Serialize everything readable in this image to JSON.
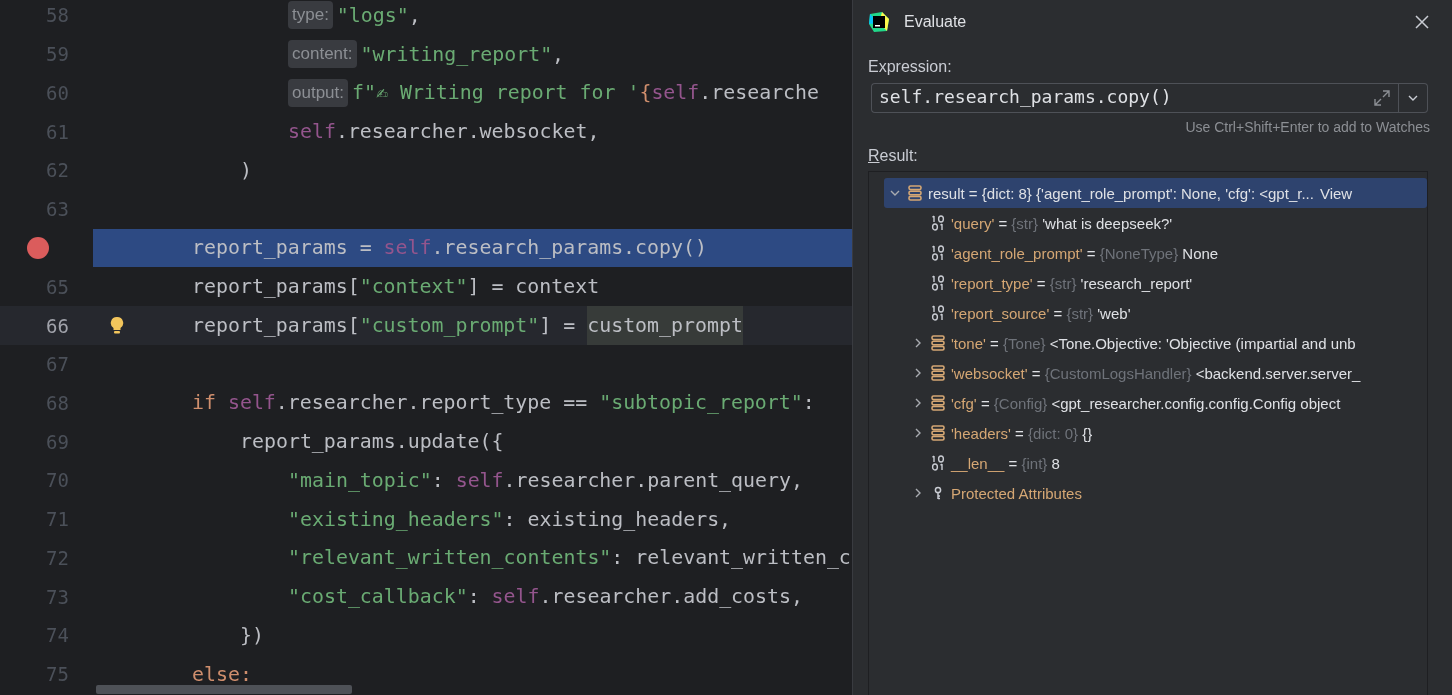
{
  "editor": {
    "lines": [
      {
        "children": [
          {
            "children": [
              {
                "number": "58",
                "tokens": [
                  {
                    "kind": "hint",
                    "text": "type:"
                  },
                  {
                    "kind": "str",
                    "text": "\"logs\""
                  },
                  {
                    "kind": "plain",
                    "text": ","
                  }
                ]
              },
              {
                "number": "59",
                "tokens": [
                  {
                    "kind": "hint",
                    "text": "content:"
                  },
                  {
                    "kind": "str",
                    "text": "\"writing_report\""
                  },
                  {
                    "kind": "plain",
                    "text": ","
                  }
                ]
              },
              {
                "number": "60",
                "tokens": [
                  {
                    "kind": "hint",
                    "text": "output:"
                  },
                  {
                    "kind": "str",
                    "text": "f\"✍ Writing report for '"
                  },
                  {
                    "kind": "kw",
                    "text": "{"
                  },
                  {
                    "kind": "self",
                    "text": "self"
                  },
                  {
                    "kind": "plain",
                    "text": ".researche"
                  }
                ]
              },
              {
                "number": "61",
                "tokens": [
                  {
                    "kind": "self",
                    "text": "self"
                  },
                  {
                    "kind": "plain",
                    "text": ".researcher.websocket,"
                  }
                ]
              }
            ]
          },
          {
            "number": "62",
            "tokens": [
              {
                "kind": "plain",
                "text": ")"
              }
            ]
          }
        ]
      },
      {
        "number": "63"
      },
      {
        "breakpoint": true,
        "execution": true,
        "tokens": [
          {
            "kind": "plain",
            "text": "report_params = "
          },
          {
            "kind": "self",
            "text": "self"
          },
          {
            "kind": "plain",
            "text": ".research_params.copy()"
          }
        ]
      },
      {
        "number": "65",
        "tokens": [
          {
            "kind": "plain",
            "text": "report_params["
          },
          {
            "kind": "str",
            "text": "\"context\""
          },
          {
            "kind": "plain",
            "text": "] = context"
          }
        ]
      },
      {
        "number": "66",
        "current": true,
        "bulb": true,
        "tokens": [
          {
            "kind": "plain",
            "text": "report_params["
          },
          {
            "kind": "str",
            "text": "\"custom_prompt\""
          },
          {
            "kind": "plain",
            "text": "] = "
          },
          {
            "kind": "usage",
            "text": "custom_prompt"
          }
        ]
      },
      {
        "number": "67"
      },
      {
        "number": "68",
        "tokens": [
          {
            "kind": "kw",
            "text": "if "
          },
          {
            "kind": "self",
            "text": "self"
          },
          {
            "kind": "plain",
            "text": ".researcher.report_type == "
          },
          {
            "kind": "str",
            "text": "\"subtopic_report\""
          },
          {
            "kind": "plain",
            "text": ":"
          }
        ],
        "children": [
          {
            "number": "69",
            "tokens": [
              {
                "kind": "plain",
                "text": "report_params.update({"
              }
            ],
            "children": [
              {
                "number": "70",
                "tokens": [
                  {
                    "kind": "str",
                    "text": "\"main_topic\""
                  },
                  {
                    "kind": "plain",
                    "text": ": "
                  },
                  {
                    "kind": "self",
                    "text": "self"
                  },
                  {
                    "kind": "plain",
                    "text": ".researcher.parent_query,"
                  }
                ]
              },
              {
                "number": "71",
                "tokens": [
                  {
                    "kind": "str",
                    "text": "\"existing_headers\""
                  },
                  {
                    "kind": "plain",
                    "text": ": existing_headers,"
                  }
                ]
              },
              {
                "number": "72",
                "tokens": [
                  {
                    "kind": "str",
                    "text": "\"relevant_written_contents\""
                  },
                  {
                    "kind": "plain",
                    "text": ": relevant_written_c"
                  }
                ]
              },
              {
                "number": "73",
                "tokens": [
                  {
                    "kind": "str",
                    "text": "\"cost_callback\""
                  },
                  {
                    "kind": "plain",
                    "text": ": "
                  },
                  {
                    "kind": "self",
                    "text": "self"
                  },
                  {
                    "kind": "plain",
                    "text": ".researcher.add_costs,"
                  }
                ]
              }
            ]
          },
          {
            "number": "74",
            "tokens": [
              {
                "kind": "plain",
                "text": "})"
              }
            ]
          }
        ]
      },
      {
        "number": "75",
        "tokens": [
          {
            "kind": "kw",
            "text": "else:"
          }
        ]
      }
    ]
  },
  "dialog": {
    "title": "Evaluate",
    "expression_label": "Expression:",
    "expression": "self.research_params.copy()",
    "hint": "Use Ctrl+Shift+Enter to add to Watches",
    "result_label": "Result:",
    "tree": [
      {
        "kind": "dict",
        "name": "result",
        "operator": "=",
        "type": "{dict: 8}",
        "value": "{'agent_role_prompt': None, 'cfg': <gpt_r...",
        "link": "View",
        "expanded": true,
        "selected": true,
        "children": [
          {
            "kind": "prim",
            "name": "'query'",
            "operator": "=",
            "type": "{str}",
            "value": "'what is deepseek?'",
            "selected": false
          },
          {
            "kind": "prim",
            "name": "'agent_role_prompt'",
            "operator": "=",
            "type": "{NoneType}",
            "value": "None",
            "selected": false
          },
          {
            "kind": "prim",
            "name": "'report_type'",
            "operator": "=",
            "type": "{str}",
            "value": "'research_report'",
            "selected": false
          },
          {
            "kind": "prim",
            "name": "'report_source'",
            "operator": "=",
            "type": "{str}",
            "value": "'web'",
            "selected": false
          },
          {
            "kind": "dict",
            "name": "'tone'",
            "operator": "=",
            "type": "{Tone}",
            "value": "<Tone.Objective: 'Objective (impartial and unb",
            "expanded": false,
            "selected": false
          },
          {
            "kind": "dict",
            "name": "'websocket'",
            "operator": "=",
            "type": "{CustomLogsHandler}",
            "value": "<backend.server.server_",
            "expanded": false,
            "selected": false
          },
          {
            "kind": "dict",
            "name": "'cfg'",
            "operator": "=",
            "type": "{Config}",
            "value": "<gpt_researcher.config.config.Config object",
            "expanded": false,
            "selected": false
          },
          {
            "kind": "dict",
            "name": "'headers'",
            "operator": "=",
            "type": "{dict: 0}",
            "value": "{}",
            "expanded": false,
            "selected": false
          },
          {
            "kind": "prim",
            "name": "__len__",
            "operator": "=",
            "type": "{int}",
            "value": "8",
            "selected": false
          },
          {
            "kind": "group",
            "name": "Protected Attributes",
            "expanded": false,
            "selected": false
          }
        ]
      }
    ]
  }
}
